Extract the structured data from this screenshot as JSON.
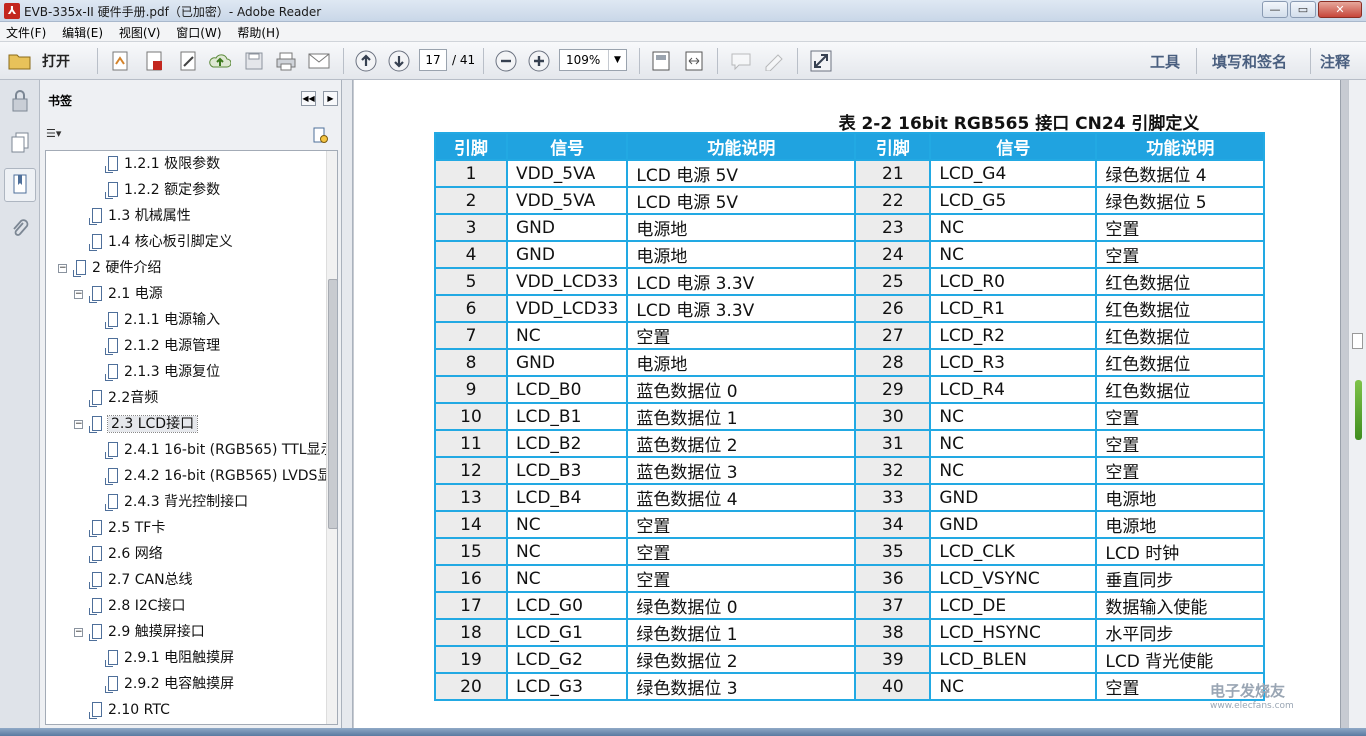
{
  "window": {
    "title": "EVB-335x-II 硬件手册.pdf（已加密）- Adobe Reader",
    "controls": {
      "minimize": "—",
      "maximize": "▭",
      "close": "✕"
    }
  },
  "menu": [
    "文件(F)",
    "编辑(E)",
    "视图(V)",
    "窗口(W)",
    "帮助(H)"
  ],
  "toolbar": {
    "open_label": "打开",
    "page_current": "17",
    "page_total": "/ 41",
    "zoom": "109%",
    "right_links": [
      "工具",
      "填写和签名",
      "注释"
    ]
  },
  "bookmarks": {
    "title": "书签",
    "items": [
      {
        "label": "1.2.1  极限参数",
        "level": 3,
        "toggle": ""
      },
      {
        "label": "1.2.2  额定参数",
        "level": 3,
        "toggle": ""
      },
      {
        "label": "1.3  机械属性",
        "level": 2,
        "toggle": ""
      },
      {
        "label": "1.4  核心板引脚定义",
        "level": 2,
        "toggle": ""
      },
      {
        "label": "2  硬件介绍",
        "level": 1,
        "toggle": "−"
      },
      {
        "label": "2.1  电源",
        "level": 2,
        "toggle": "−"
      },
      {
        "label": "2.1.1  电源输入",
        "level": 3,
        "toggle": ""
      },
      {
        "label": "2.1.2  电源管理",
        "level": 3,
        "toggle": ""
      },
      {
        "label": "2.1.3  电源复位",
        "level": 3,
        "toggle": ""
      },
      {
        "label": "2.2音频",
        "level": 2,
        "toggle": ""
      },
      {
        "label": "2.3  LCD接口",
        "level": 2,
        "toggle": "−",
        "selected": true
      },
      {
        "label": "2.4.1  16-bit (RGB565) TTL显示",
        "level": 3,
        "toggle": ""
      },
      {
        "label": "2.4.2  16-bit (RGB565) LVDS显",
        "level": 3,
        "toggle": ""
      },
      {
        "label": "2.4.3  背光控制接口",
        "level": 3,
        "toggle": ""
      },
      {
        "label": "2.5  TF卡",
        "level": 2,
        "toggle": ""
      },
      {
        "label": "2.6  网络",
        "level": 2,
        "toggle": ""
      },
      {
        "label": "2.7  CAN总线",
        "level": 2,
        "toggle": ""
      },
      {
        "label": "2.8  I2C接口",
        "level": 2,
        "toggle": ""
      },
      {
        "label": "2.9  触摸屏接口",
        "level": 2,
        "toggle": "−"
      },
      {
        "label": "2.9.1  电阻触摸屏",
        "level": 3,
        "toggle": ""
      },
      {
        "label": "2.9.2  电容触摸屏",
        "level": 3,
        "toggle": ""
      },
      {
        "label": "2.10  RTC",
        "level": 2,
        "toggle": ""
      }
    ]
  },
  "document": {
    "caption": "表 2-2    16bit RGB565 接口 CN24 引脚定义",
    "headers": [
      "引脚",
      "信号",
      "功能说明",
      "引脚",
      "信号",
      "功能说明"
    ],
    "rows": [
      [
        "1",
        "VDD_5VA",
        "LCD 电源 5V",
        "21",
        "LCD_G4",
        "绿色数据位 4"
      ],
      [
        "2",
        "VDD_5VA",
        "LCD 电源 5V",
        "22",
        "LCD_G5",
        "绿色数据位 5"
      ],
      [
        "3",
        "GND",
        "电源地",
        "23",
        "NC",
        "空置"
      ],
      [
        "4",
        "GND",
        "电源地",
        "24",
        "NC",
        "空置"
      ],
      [
        "5",
        "VDD_LCD33",
        "LCD 电源 3.3V",
        "25",
        "LCD_R0",
        "红色数据位"
      ],
      [
        "6",
        "VDD_LCD33",
        "LCD 电源 3.3V",
        "26",
        "LCD_R1",
        "红色数据位"
      ],
      [
        "7",
        "NC",
        "空置",
        "27",
        "LCD_R2",
        "红色数据位"
      ],
      [
        "8",
        "GND",
        "电源地",
        "28",
        "LCD_R3",
        "红色数据位"
      ],
      [
        "9",
        "LCD_B0",
        "蓝色数据位 0",
        "29",
        "LCD_R4",
        "红色数据位"
      ],
      [
        "10",
        "LCD_B1",
        "蓝色数据位 1",
        "30",
        "NC",
        "空置"
      ],
      [
        "11",
        "LCD_B2",
        "蓝色数据位 2",
        "31",
        "NC",
        "空置"
      ],
      [
        "12",
        "LCD_B3",
        "蓝色数据位 3",
        "32",
        "NC",
        "空置"
      ],
      [
        "13",
        "LCD_B4",
        "蓝色数据位 4",
        "33",
        "GND",
        "电源地"
      ],
      [
        "14",
        "NC",
        "空置",
        "34",
        "GND",
        "电源地"
      ],
      [
        "15",
        "NC",
        "空置",
        "35",
        "LCD_CLK",
        "LCD 时钟"
      ],
      [
        "16",
        "NC",
        "空置",
        "36",
        "LCD_VSYNC",
        "垂直同步"
      ],
      [
        "17",
        "LCD_G0",
        "绿色数据位 0",
        "37",
        "LCD_DE",
        "数据输入使能"
      ],
      [
        "18",
        "LCD_G1",
        "绿色数据位 1",
        "38",
        "LCD_HSYNC",
        "水平同步"
      ],
      [
        "19",
        "LCD_G2",
        "绿色数据位 2",
        "39",
        "LCD_BLEN",
        "LCD 背光使能"
      ],
      [
        "20",
        "LCD_G3",
        "绿色数据位 3",
        "40",
        "NC",
        "空置"
      ]
    ]
  },
  "watermark": {
    "line1": "电子发烧友",
    "line2": "www.elecfans.com"
  },
  "colors": {
    "table_header": "#20a3e0",
    "table_border": "#22a9e3",
    "pin_cell": "#ececec"
  }
}
